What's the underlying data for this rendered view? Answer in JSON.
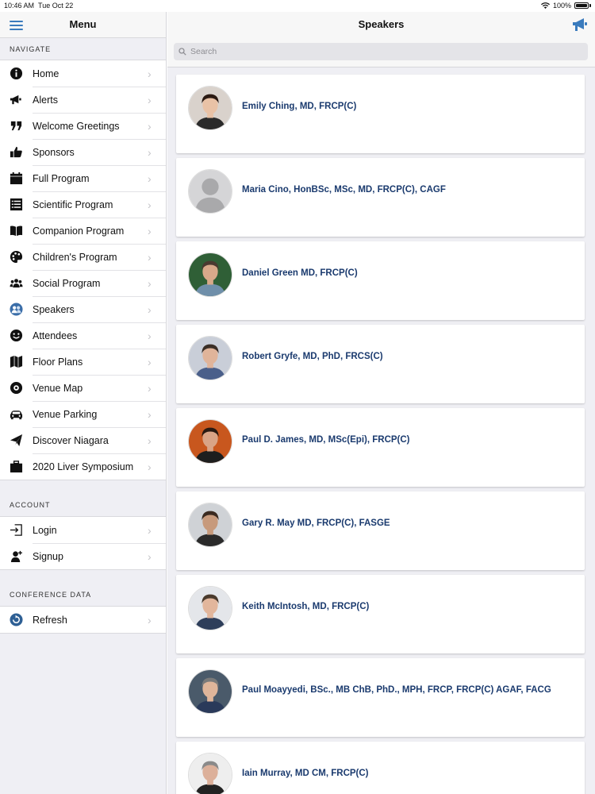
{
  "status": {
    "time": "10:46 AM",
    "date": "Tue Oct 22",
    "battery": "100%"
  },
  "sidebar": {
    "title": "Menu",
    "navigate_label": "NAVIGATE",
    "account_label": "ACCOUNT",
    "conference_label": "CONFERENCE DATA",
    "nav_items": [
      {
        "label": "Home",
        "icon": "info-icon"
      },
      {
        "label": "Alerts",
        "icon": "megaphone-icon"
      },
      {
        "label": "Welcome Greetings",
        "icon": "quote-icon"
      },
      {
        "label": "Sponsors",
        "icon": "thumbs-up-icon"
      },
      {
        "label": "Full Program",
        "icon": "calendar-icon"
      },
      {
        "label": "Scientific Program",
        "icon": "list-icon"
      },
      {
        "label": "Companion Program",
        "icon": "book-icon"
      },
      {
        "label": "Children's Program",
        "icon": "palette-icon"
      },
      {
        "label": "Social Program",
        "icon": "group-icon"
      },
      {
        "label": "Speakers",
        "icon": "speakers-icon"
      },
      {
        "label": "Attendees",
        "icon": "smiley-icon"
      },
      {
        "label": "Floor Plans",
        "icon": "map-icon"
      },
      {
        "label": "Venue Map",
        "icon": "location-icon"
      },
      {
        "label": "Venue Parking",
        "icon": "car-icon"
      },
      {
        "label": "Discover Niagara",
        "icon": "paper-plane-icon"
      },
      {
        "label": "2020 Liver Symposium",
        "icon": "briefcase-icon"
      }
    ],
    "account_items": [
      {
        "label": "Login",
        "icon": "login-icon"
      },
      {
        "label": "Signup",
        "icon": "add-user-icon"
      }
    ],
    "conference_items": [
      {
        "label": "Refresh",
        "icon": "refresh-icon"
      }
    ]
  },
  "main": {
    "title": "Speakers",
    "search_placeholder": "Search",
    "speakers": [
      {
        "name": "Emily Ching, MD, FRCP(C)"
      },
      {
        "name": "Maria Cino, HonBSc, MSc, MD, FRCP(C), CAGF"
      },
      {
        "name": "Daniel Green MD, FRCP(C)"
      },
      {
        "name": "Robert Gryfe, MD, PhD, FRCS(C)"
      },
      {
        "name": "Paul D. James, MD, MSc(Epi), FRCP(C)"
      },
      {
        "name": "Gary R. May MD, FRCP(C), FASGE"
      },
      {
        "name": "Keith McIntosh, MD, FRCP(C)"
      },
      {
        "name": "Paul Moayyedi, BSc., MB ChB, PhD., MPH, FRCP, FRCP(C) AGAF, FACG"
      },
      {
        "name": "Iain Murray, MD CM, FRCP(C)"
      }
    ]
  },
  "colors": {
    "accent": "#3a7bbd",
    "name_text": "#1a3a6e",
    "background": "#efeff4"
  }
}
